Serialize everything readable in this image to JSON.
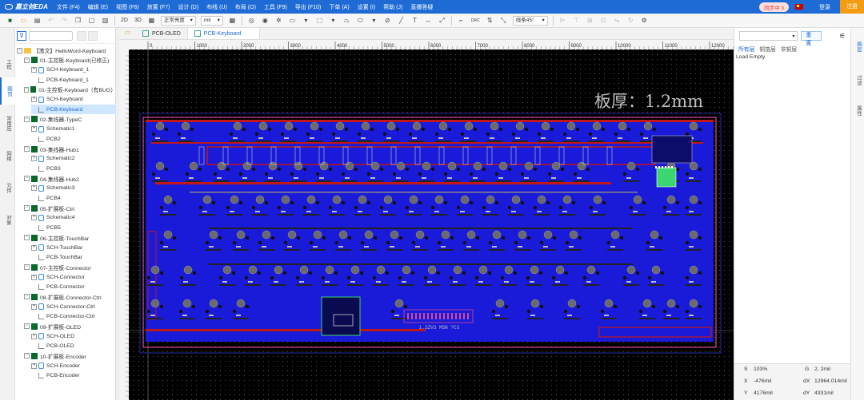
{
  "app": {
    "logo": "嘉立创EDA"
  },
  "menu": [
    "文件 (F4)",
    "编辑 (E)",
    "视图 (F6)",
    "放置 (F7)",
    "设计 (D)",
    "布线 (U)",
    "布局 (O)",
    "工具 (F9)",
    "导出 (F10)",
    "下单 (A)",
    "设置 (I)",
    "帮助 (J)",
    "直播答疑"
  ],
  "header_right": {
    "sync": "同步中 3",
    "login": "登录",
    "register": "注册"
  },
  "toolbar": {
    "btn_2d": "2D",
    "btn_3d": "3D",
    "view_mode": "正常亮度",
    "unit": "mil",
    "route_angle": "线条45°"
  },
  "left_tabs": [
    "工程",
    "图页",
    "常用库",
    "网络",
    "元件",
    "对象"
  ],
  "tree": [
    {
      "label": "【激文】HelloWord-Keyboard",
      "type": "folder",
      "depth": 0,
      "exp": "−"
    },
    {
      "label": "01-主控板-Keyboard(已修正)",
      "type": "board",
      "depth": 1,
      "exp": "−"
    },
    {
      "label": "SCH-Keyboard_1",
      "type": "sch",
      "depth": 2,
      "exp": "+"
    },
    {
      "label": "PCB-Keyboard_1",
      "type": "pcb",
      "depth": 2,
      "exp": ""
    },
    {
      "label": "01-主控板-Keyboard（有BUG）",
      "type": "board",
      "depth": 1,
      "exp": "−"
    },
    {
      "label": "SCH-Keyboard",
      "type": "sch",
      "depth": 2,
      "exp": "+"
    },
    {
      "label": "PCB-Keyboard",
      "type": "pcb",
      "depth": 2,
      "exp": "",
      "selected": true
    },
    {
      "label": "02-集线器-TypeC",
      "type": "board",
      "depth": 1,
      "exp": "−"
    },
    {
      "label": "Schematic1",
      "type": "sch",
      "depth": 2,
      "exp": "+"
    },
    {
      "label": "PCB2",
      "type": "pcb",
      "depth": 2,
      "exp": ""
    },
    {
      "label": "03-集线器-Hub1",
      "type": "board",
      "depth": 1,
      "exp": "−"
    },
    {
      "label": "Schematic2",
      "type": "sch",
      "depth": 2,
      "exp": "+"
    },
    {
      "label": "PCB3",
      "type": "pcb",
      "depth": 2,
      "exp": ""
    },
    {
      "label": "04-集线器-Hub2",
      "type": "board",
      "depth": 1,
      "exp": "−"
    },
    {
      "label": "Schematic3",
      "type": "sch",
      "depth": 2,
      "exp": "+"
    },
    {
      "label": "PCB4",
      "type": "pcb",
      "depth": 2,
      "exp": ""
    },
    {
      "label": "05-扩展板-Ctrl",
      "type": "board",
      "depth": 1,
      "exp": "−"
    },
    {
      "label": "Schematic4",
      "type": "sch",
      "depth": 2,
      "exp": "+"
    },
    {
      "label": "PCB5",
      "type": "pcb",
      "depth": 2,
      "exp": ""
    },
    {
      "label": "06-主控板-TouchBar",
      "type": "board",
      "depth": 1,
      "exp": "−"
    },
    {
      "label": "SCH-TouchBar",
      "type": "sch",
      "depth": 2,
      "exp": "+"
    },
    {
      "label": "PCB-TouchBar",
      "type": "pcb",
      "depth": 2,
      "exp": ""
    },
    {
      "label": "07-主控板-Connector",
      "type": "board",
      "depth": 1,
      "exp": "−"
    },
    {
      "label": "SCH-Connector",
      "type": "sch",
      "depth": 2,
      "exp": "+"
    },
    {
      "label": "PCB-Connector",
      "type": "pcb",
      "depth": 2,
      "exp": ""
    },
    {
      "label": "08-扩展板-Connector-Ctrl",
      "type": "board",
      "depth": 1,
      "exp": "−"
    },
    {
      "label": "SCH-Connector-Ctrl",
      "type": "sch",
      "depth": 2,
      "exp": "+"
    },
    {
      "label": "PCB-Connector-Ctrl",
      "type": "pcb",
      "depth": 2,
      "exp": ""
    },
    {
      "label": "09-扩展板-OLED",
      "type": "board",
      "depth": 1,
      "exp": "−"
    },
    {
      "label": "SCH-OLED",
      "type": "sch",
      "depth": 2,
      "exp": "+"
    },
    {
      "label": "PCB-OLED",
      "type": "pcb",
      "depth": 2,
      "exp": ""
    },
    {
      "label": "10-扩展板-Encoder",
      "type": "board",
      "depth": 1,
      "exp": "−"
    },
    {
      "label": "SCH-Encoder",
      "type": "sch",
      "depth": 2,
      "exp": "+"
    },
    {
      "label": "PCB-Encoder",
      "type": "pcb",
      "depth": 2,
      "exp": ""
    }
  ],
  "doc_tabs": [
    {
      "label": "PCB-OLED",
      "active": false
    },
    {
      "label": "PCB-Keyboard",
      "active": true
    }
  ],
  "canvas": {
    "annotation": "板厚：1.2mm",
    "ruler_marks": [
      "0",
      "1000",
      "2000",
      "3000",
      "4000",
      "5000",
      "6000",
      "7000",
      "8000",
      "9000",
      "10000",
      "11000",
      "12000"
    ],
    "board_silk": "1.2ZV3 MSN ?C3",
    "colors": {
      "background": "#000000",
      "copper": "#1a1ad9",
      "trace": "#c01818",
      "outline": "#d04a9a",
      "pads": "#6a6a6a"
    }
  },
  "right_panel": {
    "reset": "重置",
    "tabs": [
      "所有层",
      "铜箔层",
      "非铜层"
    ],
    "empty_text": "Load Empty",
    "status": {
      "s_label": "S",
      "s_value": "103%",
      "g_label": "G",
      "g_value": "2, 2mil",
      "x_label": "X",
      "x_value": "-476mil",
      "dx_label": "dX",
      "dx_value": "12964.014mil",
      "y_label": "Y",
      "y_value": "4176mil",
      "dy_label": "dY",
      "dy_value": "4331mil"
    }
  },
  "right_tabs": [
    "图层",
    "过滤",
    "属性"
  ]
}
